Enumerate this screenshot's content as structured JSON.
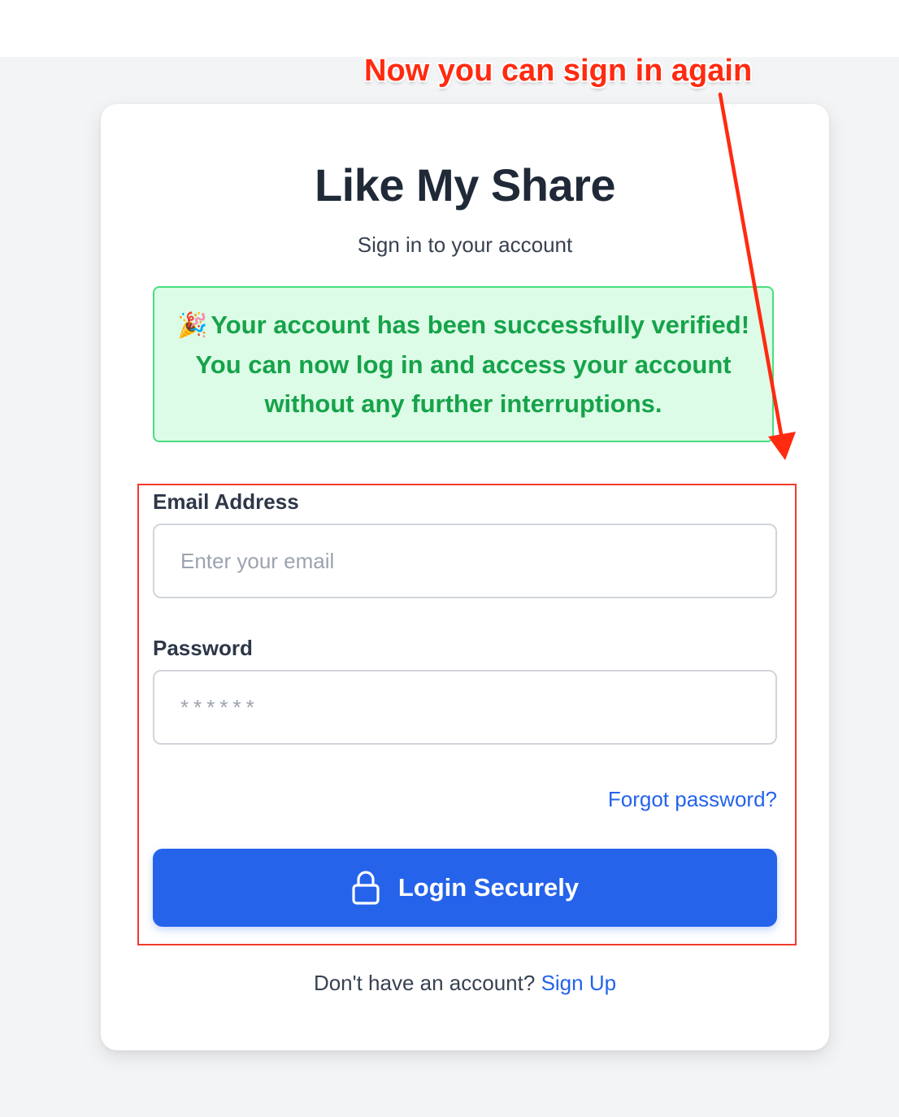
{
  "app": {
    "title": "Like My Share",
    "subtitle": "Sign in to your account"
  },
  "alert": {
    "icon": "party-popper-icon",
    "glyph": "🎉",
    "message": "Your account has been successfully verified! You can now log in and access your account without any further interruptions."
  },
  "form": {
    "email_label": "Email Address",
    "email_placeholder": "Enter your email",
    "email_value": "",
    "password_label": "Password",
    "password_placeholder": "******",
    "password_value": "",
    "forgot_link": "Forgot password?",
    "login_button": "Login Securely",
    "login_icon": "lock-icon"
  },
  "footer": {
    "prompt": "Don't have an account?",
    "signup_link": "Sign Up"
  },
  "annotation": {
    "text": "Now you can sign in again",
    "color": "#ff2a10"
  },
  "colors": {
    "primary": "#2563eb",
    "success_bg": "#dcfce7",
    "success_border": "#4ade80",
    "success_text": "#16a34a",
    "page_bg": "#f3f4f6",
    "highlight": "#ef3b2d"
  }
}
